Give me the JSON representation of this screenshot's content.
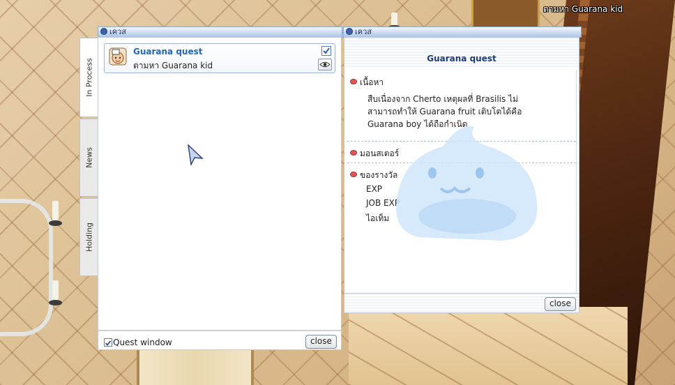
{
  "scene": {
    "caption": "ตามหา Guarana kid"
  },
  "quest_window": {
    "title": "เควส",
    "tabs": [
      {
        "label": "In Process",
        "active": true
      },
      {
        "label": "News",
        "active": false
      },
      {
        "label": "Holding",
        "active": false
      }
    ],
    "quests": [
      {
        "title": "Guarana quest",
        "subtitle": "ตามหา Guarana kid",
        "checked": true
      }
    ],
    "footer": {
      "checkbox_label": "Quest window",
      "checkbox_checked": true,
      "close_label": "close"
    }
  },
  "detail_window": {
    "title": "เควส",
    "quest_title": "Guarana quest",
    "sections": {
      "content_label": "เนื้อหา",
      "content_text": "สืบเนื่องจาก Cherto เหตุผลที่ Brasilis ไม่สามารถทำให้ Guarana fruit เติบโตได้คือ Guarana boy ได้ถือกำเนิด",
      "monster_label": "มอนสเตอร์",
      "reward_label": "ของรางวัล",
      "rewards": [
        "EXP",
        "JOB EXP",
        "ไอเท็ม"
      ]
    },
    "close_label": "close"
  },
  "colors": {
    "title_blue": "#2467b8",
    "titlebar": "#aec4e6",
    "bullet": "#d85a5a"
  }
}
